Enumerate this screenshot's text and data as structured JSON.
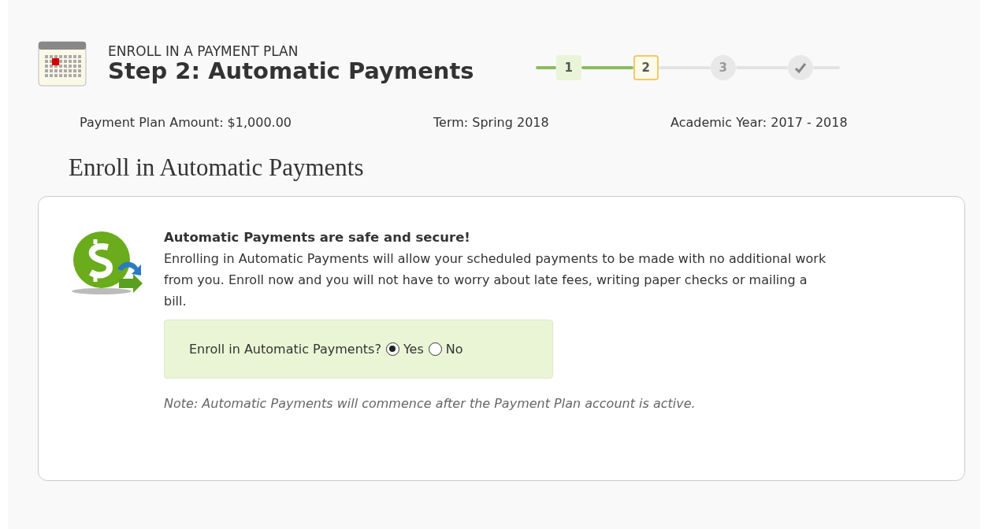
{
  "header": {
    "eyebrow": "ENROLL IN A PAYMENT PLAN",
    "title": "Step 2: Automatic Payments"
  },
  "steps": [
    {
      "kind": "number",
      "label": "1",
      "completed": true,
      "selected": false
    },
    {
      "kind": "number",
      "label": "2",
      "completed": false,
      "selected": true
    },
    {
      "kind": "number",
      "label": "3",
      "completed": false,
      "selected": false
    },
    {
      "kind": "check",
      "completed": false,
      "selected": false
    }
  ],
  "summary": [
    "Payment Plan Amount: $1,000.00",
    "Term: Spring 2018",
    "Academic Year: 2017 - 2018"
  ],
  "section_title": "Enroll in Automatic Payments",
  "card": {
    "heading": "Automatic Payments are safe and secure!",
    "body": "Enrolling in Automatic Payments will allow your scheduled payments to be made with no additional work from you. Enroll now and you will not have to worry about late fees, writing paper checks or mailing a bill.",
    "question": "Enroll in Automatic Payments?",
    "options": [
      {
        "label": "Yes",
        "selected": true
      },
      {
        "label": "No",
        "selected": false
      }
    ],
    "note": "Note: Automatic Payments will commence after the Payment Plan account is active."
  }
}
